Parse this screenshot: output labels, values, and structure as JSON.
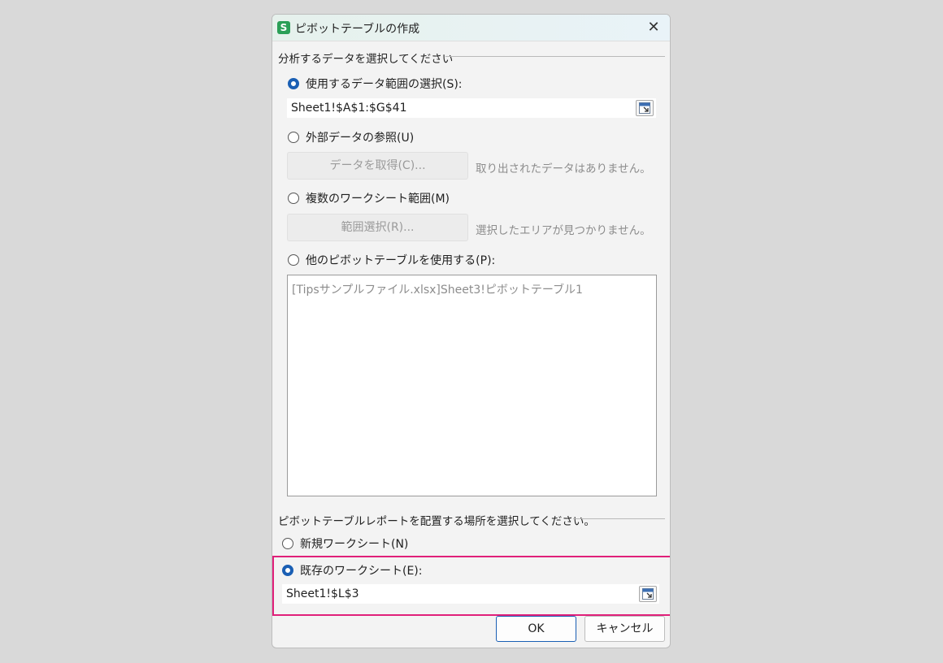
{
  "dialog": {
    "title": "ピボットテーブルの作成",
    "app_icon_letter": "S"
  },
  "source": {
    "group_label": "分析するデータを選択してください",
    "use_range_label": "使用するデータ範囲の選択(S):",
    "range_value": "Sheet1!$A$1:$G$41",
    "external_label": "外部データの参照(U)",
    "get_data_button": "データを取得(C)...",
    "no_data_hint": "取り出されたデータはありません。",
    "multi_sheet_label": "複数のワークシート範囲(M)",
    "range_select_button": "範囲選択(R)...",
    "no_area_hint": "選択したエリアが見つかりません。",
    "other_pivot_label": "他のピボットテーブルを使用する(P):",
    "pivot_list": [
      "[Tipsサンプルファイル.xlsx]Sheet3!ピボットテーブル1"
    ]
  },
  "destination": {
    "group_label": "ピボットテーブルレポートを配置する場所を選択してください。",
    "new_sheet_label": "新規ワークシート(N)",
    "existing_sheet_label": "既存のワークシート(E):",
    "existing_value": "Sheet1!$L$3"
  },
  "buttons": {
    "ok": "OK",
    "cancel": "キャンセル"
  },
  "colors": {
    "accent": "#1a5fb4",
    "highlight": "#e0207a",
    "app_icon": "#2b9f57"
  }
}
